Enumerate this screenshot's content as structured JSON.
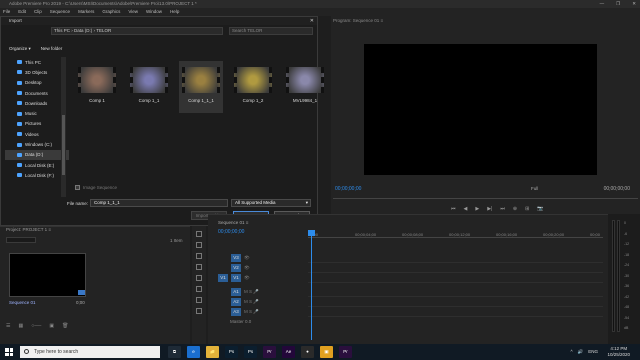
{
  "window": {
    "title": "Adobe Premiere Pro 2019 - C:\\Users\\MSI\\Documents\\Adobe\\Premiere Pro\\13.0\\PROJECT 1 *",
    "controls": [
      "—",
      "❐",
      "✕"
    ]
  },
  "menubar": [
    "File",
    "Edit",
    "Clip",
    "Sequence",
    "Markers",
    "Graphics",
    "View",
    "Window",
    "Help"
  ],
  "dialog": {
    "title": "Import",
    "address": {
      "path": [
        "This PC",
        "Data (D:)",
        "TELOR"
      ],
      "search_placeholder": "Search TELOR"
    },
    "toolbar": {
      "organize": "Organize ▾",
      "new_folder": "New folder"
    },
    "nav_items": [
      {
        "label": "This PC",
        "icon": "pc-icon"
      },
      {
        "label": "3D Objects",
        "icon": "cube-icon"
      },
      {
        "label": "Desktop",
        "icon": "desktop-icon"
      },
      {
        "label": "Documents",
        "icon": "document-icon"
      },
      {
        "label": "Downloads",
        "icon": "download-icon"
      },
      {
        "label": "Music",
        "icon": "music-icon"
      },
      {
        "label": "Pictures",
        "icon": "pictures-icon"
      },
      {
        "label": "Videos",
        "icon": "video-icon"
      },
      {
        "label": "Windows (C:)",
        "icon": "drive-icon"
      },
      {
        "label": "Data (D:)",
        "icon": "drive-icon",
        "selected": true
      },
      {
        "label": "Local Disk (E:)",
        "icon": "drive-icon"
      },
      {
        "label": "Local Disk (F:)",
        "icon": "drive-icon"
      }
    ],
    "files": [
      {
        "name": "Comp 1",
        "color": "#8a6a5a",
        "selected": false
      },
      {
        "name": "Comp 1_1",
        "color": "#7a7ab0",
        "selected": false
      },
      {
        "name": "Comp 1_1_1",
        "color": "#9a8040",
        "selected": true
      },
      {
        "name": "Comp 1_2",
        "color": "#b09a40",
        "selected": false
      },
      {
        "name": "MVL9984_1",
        "color": "#8a88aa",
        "selected": false
      }
    ],
    "image_sequence_label": "Image Sequence",
    "file_name_label": "File name:",
    "file_name_value": "Comp 1_1_1",
    "file_type": "All Supported Media",
    "buttons": {
      "import_folder": "Import Folder",
      "open": "Open",
      "cancel": "Cancel"
    }
  },
  "program_monitor": {
    "tab": "Program: Sequence 01 ≡",
    "timecode_left": "00;00;00;00",
    "fit": "Full",
    "timecode_right": "00;00;00;00",
    "controls": [
      "⏮",
      "◀",
      "▶",
      "▶|",
      "⏭",
      "⊕",
      "⊞",
      "📷"
    ]
  },
  "project": {
    "tab": "Project: PROJECT 1 ≡",
    "item_count": "1 Item",
    "sequence_name": "Sequence 01",
    "sequence_duration": "0;00"
  },
  "timeline": {
    "tab": "Sequence 01 ≡",
    "timecode": "00;00;00;00",
    "ruler": [
      "00;00",
      "00;00;04;00",
      "00;00;08;00",
      "00;00;12;00",
      "00;00;16;00",
      "00;00;20;00",
      "00;00"
    ],
    "tracks": [
      {
        "label": "V3",
        "src": "",
        "icons": "👁"
      },
      {
        "label": "V2",
        "src": "",
        "icons": "👁"
      },
      {
        "label": "V1",
        "src": "V1",
        "icons": "👁"
      },
      {
        "label": "A1",
        "src": "",
        "icons": "M S 🎤"
      },
      {
        "label": "A2",
        "src": "",
        "icons": "M S 🎤"
      },
      {
        "label": "A3",
        "src": "",
        "icons": "M S 🎤"
      }
    ],
    "master": "Master  0.0"
  },
  "meters": {
    "scale": [
      "0",
      "-6",
      "-12",
      "-18",
      "-24",
      "-30",
      "-36",
      "-42",
      "-48",
      "-54",
      "dB"
    ]
  },
  "taskbar": {
    "search_placeholder": "Type here to search",
    "apps": [
      {
        "label": "⧉",
        "color": "#1e2a36"
      },
      {
        "label": "e",
        "color": "#1a6fd0"
      },
      {
        "label": "📁",
        "color": "#e2b23a"
      },
      {
        "label": "Ps",
        "color": "#0b1e2e"
      },
      {
        "label": "Ps",
        "color": "#0b1e2e"
      },
      {
        "label": "Pr",
        "color": "#2a0f3d"
      },
      {
        "label": "Ae",
        "color": "#23073a"
      },
      {
        "label": "●",
        "color": "#2a2a2a"
      },
      {
        "label": "▣",
        "color": "#e0a020"
      },
      {
        "label": "Pr",
        "color": "#2a0f3d"
      }
    ],
    "tray": [
      "^",
      "🔊",
      "ENG"
    ],
    "time": "4:12 PM",
    "date": "10/25/2020"
  },
  "colors": {
    "accent": "#2d8ceb",
    "panel": "#232323",
    "background": "#1e1e1e"
  }
}
